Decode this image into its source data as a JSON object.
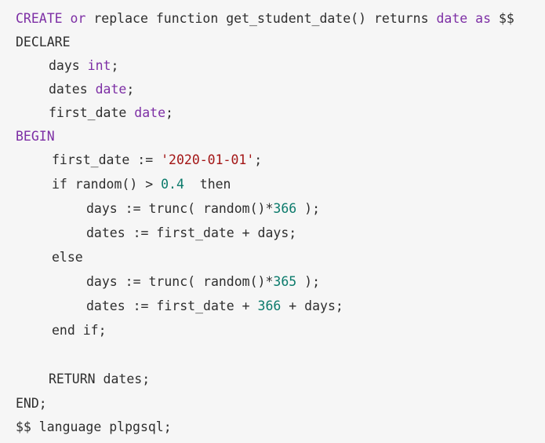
{
  "code": {
    "language_label": "plpgsql",
    "lines": [
      {
        "tokens": [
          {
            "t": "CREATE",
            "k": "kw"
          },
          {
            "t": " or ",
            "k": "kw"
          },
          {
            "t": "replace function get_student_date() returns ",
            "k": "plain"
          },
          {
            "t": "date",
            "k": "kw"
          },
          {
            "t": " ",
            "k": "plain"
          },
          {
            "t": "as",
            "k": "kw"
          },
          {
            "t": " $$",
            "k": "plain"
          }
        ]
      },
      {
        "tokens": [
          {
            "t": "DECLARE",
            "k": "plain"
          }
        ]
      },
      {
        "tokens": [
          {
            "t": "    days ",
            "k": "plain"
          },
          {
            "t": "int",
            "k": "kw"
          },
          {
            "t": ";",
            "k": "plain"
          }
        ]
      },
      {
        "tokens": [
          {
            "t": "    dates ",
            "k": "plain"
          },
          {
            "t": "date",
            "k": "kw"
          },
          {
            "t": ";",
            "k": "plain"
          }
        ]
      },
      {
        "tokens": [
          {
            "t": "    first_date ",
            "k": "plain"
          },
          {
            "t": "date",
            "k": "kw"
          },
          {
            "t": ";",
            "k": "plain"
          }
        ]
      },
      {
        "tokens": [
          {
            "t": "BEGIN",
            "k": "kw"
          }
        ]
      },
      {
        "tokens": [
          {
            "t": "    first_date := ",
            "k": "plain"
          },
          {
            "t": "'2020-01-01'",
            "k": "str"
          },
          {
            "t": ";",
            "k": "plain"
          }
        ]
      },
      {
        "tokens": [
          {
            "t": "    if random() > ",
            "k": "plain"
          },
          {
            "t": "0.4",
            "k": "num"
          },
          {
            "t": "  then",
            "k": "plain"
          }
        ]
      },
      {
        "tokens": [
          {
            "t": "        days := trunc( random()*",
            "k": "plain"
          },
          {
            "t": "366",
            "k": "num"
          },
          {
            "t": " );",
            "k": "plain"
          }
        ]
      },
      {
        "tokens": [
          {
            "t": "        dates := first_date + days;",
            "k": "plain"
          }
        ]
      },
      {
        "tokens": [
          {
            "t": "    else",
            "k": "plain"
          }
        ]
      },
      {
        "tokens": [
          {
            "t": "        days := trunc( random()*",
            "k": "plain"
          },
          {
            "t": "365",
            "k": "num"
          },
          {
            "t": " );",
            "k": "plain"
          }
        ]
      },
      {
        "tokens": [
          {
            "t": "        dates := first_date + ",
            "k": "plain"
          },
          {
            "t": "366",
            "k": "num"
          },
          {
            "t": " + days;",
            "k": "plain"
          }
        ]
      },
      {
        "tokens": [
          {
            "t": "    end if;",
            "k": "plain"
          }
        ]
      },
      {
        "tokens": [
          {
            "t": "",
            "k": "plain"
          }
        ]
      },
      {
        "tokens": [
          {
            "t": "    RETURN dates;",
            "k": "plain"
          }
        ]
      },
      {
        "tokens": [
          {
            "t": "END;",
            "k": "plain"
          }
        ]
      },
      {
        "tokens": [
          {
            "t": "$$ language plpgsql;",
            "k": "plain"
          }
        ]
      }
    ]
  }
}
